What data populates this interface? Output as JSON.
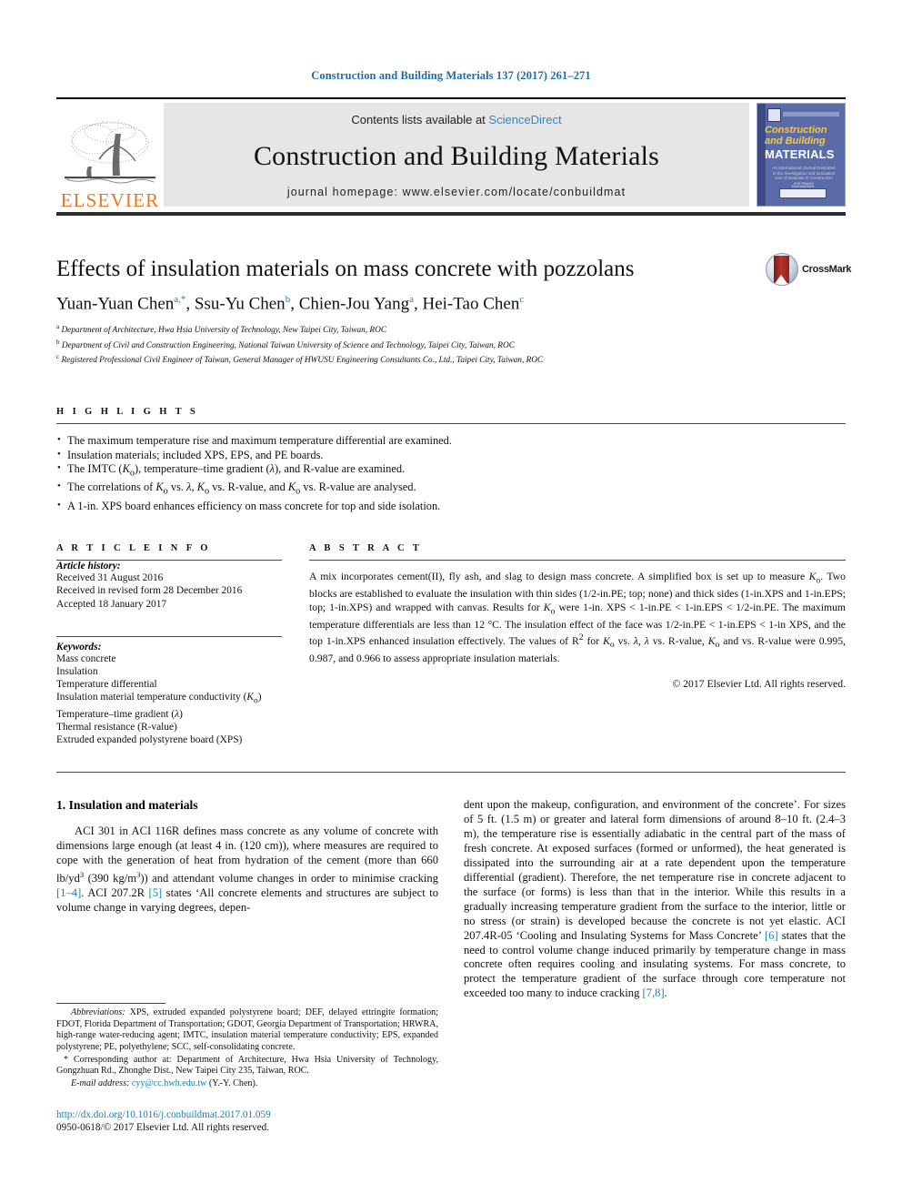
{
  "running_head": "Construction and Building Materials 137 (2017) 261–271",
  "masthead": {
    "publisher_name": "ELSEVIER",
    "contents_prefix": "Contents lists available at ",
    "contents_link": "ScienceDirect",
    "journal_title": "Construction and Building Materials",
    "homepage_label": "journal homepage: www.elsevier.com/locate/conbuildmat",
    "cover": {
      "line1": "Construction",
      "line2": "and Building",
      "line3": "MATERIALS",
      "blurb": "An International Journal Dedicated to the Investigation and Innovative Use of Materials in Construction and Repair",
      "footer_label": "ScienceDirect"
    }
  },
  "article": {
    "title": "Effects of insulation materials on mass concrete with pozzolans",
    "authors_html": "Yuan-Yuan Chen<sup>a,*</sup>, Ssu-Yu Chen<sup>b</sup>, Chien-Jou Yang<sup>a</sup>, Hei-Tao Chen<sup>c</sup>",
    "affiliations": [
      "Department of Architecture, Hwa Hsia University of Technology, New Taipei City, Taiwan, ROC",
      "Department of Civil and Construction Engineering, National Taiwan University of Science and Technology, Taipei City, Taiwan, ROC",
      "Registered Professional Civil Engineer of Taiwan, General Manager of HWUSU Engineering Consultants Co., Ltd., Taipei City, Taiwan, ROC"
    ],
    "affiliation_markers": [
      "a",
      "b",
      "c"
    ],
    "crossmark_label": "CrossMark"
  },
  "highlights": {
    "heading": "H I G H L I G H T S",
    "items_html": [
      "The maximum temperature rise and maximum temperature differential are examined.",
      "Insulation materials; included XPS, EPS, and PE boards.",
      "The IMTC (<i>K</i><sub>o</sub>), temperature–time gradient (<i>&lambda;</i>), and R-value are examined.",
      "The correlations of <i>K</i><sub>o</sub> vs. <i>&lambda;</i>, <i>K</i><sub>o</sub> vs. R-value, and <i>K</i><sub>o</sub> vs. R-value are analysed.",
      "A 1-in. XPS board enhances efficiency on mass concrete for top and side isolation."
    ]
  },
  "article_info": {
    "heading": "A R T I C L E   I N F O",
    "history_title": "Article history:",
    "history": [
      "Received 31 August 2016",
      "Received in revised form 28 December 2016",
      "Accepted 18 January 2017"
    ],
    "keywords_title": "Keywords:",
    "keywords_html": [
      "Mass concrete",
      "Insulation",
      "Temperature differential",
      "Insulation material temperature conductivity (<i>K</i><sub>o</sub>)",
      "Temperature–time gradient (<i>&lambda;</i>)",
      "Thermal resistance (R-value)",
      "Extruded expanded polystyrene board (XPS)"
    ]
  },
  "abstract": {
    "heading": "A B S T R A C T",
    "body_html": "A mix incorporates cement(II), fly ash, and slag to design mass concrete. A simplified box is set up to measure <i>K</i><sub>o</sub>. Two blocks are established to evaluate the insulation with thin sides (1/2-in.PE; top; none) and thick sides (1-in.XPS and 1-in.EPS; top; 1-in.XPS) and wrapped with canvas. Results for <i>K</i><sub>o</sub> were 1-in. XPS &lt; 1-in.PE &lt; 1-in.EPS &lt; 1/2-in.PE. The maximum temperature differentials are less than 12 &deg;C. The insulation effect of the face was 1/2-in.PE &lt; 1-in.EPS &lt; 1-in XPS, and the top 1-in.XPS enhanced insulation effectively. The values of R<sup>2</sup> for <i>K</i><sub>o</sub> vs. <i>&lambda;</i>, <i>&lambda;</i> vs. R-value, <i>K</i><sub>o</sub> and vs. R-value were 0.995, 0.987, and 0.966 to assess appropriate insulation materials.",
    "copyright": "© 2017 Elsevier Ltd. All rights reserved."
  },
  "body": {
    "section_heading": "1. Insulation and materials",
    "left_paragraph_html": "ACI 301 in ACI 116R defines mass concrete as any volume of concrete with dimensions large enough (at least 4 in. (120 cm)), where measures are required to cope with the generation of heat from hydration of the cement (more than 660 lb/yd<sup>3</sup> (390 kg/m<sup>3</sup>)) and attendant volume changes in order to minimise cracking <span class=\"ref\">[1–4]</span>. ACI 207.2R <span class=\"ref\">[5]</span> states ‘All concrete elements and structures are subject to volume change in varying degrees, depen-",
    "right_paragraph_html": "dent upon the makeup, configuration, and environment of the concrete’. For sizes of 5 ft. (1.5 m) or greater and lateral form dimensions of around 8–10 ft. (2.4–3 m), the temperature rise is essentially adiabatic in the central part of the mass of fresh concrete. At exposed surfaces (formed or unformed), the heat generated is dissipated into the surrounding air at a rate dependent upon the temperature differential (gradient). Therefore, the net temperature rise in concrete adjacent to the surface (or forms) is less than that in the interior. While this results in a gradually increasing temperature gradient from the surface to the interior, little or no stress (or strain) is developed because the concrete is not yet elastic. ACI 207.4R-05 ‘Cooling and Insulating Systems for Mass Concrete’ <span class=\"ref\">[6]</span> states that the need to control volume change induced primarily by temperature change in mass concrete often requires cooling and insulating systems. For mass concrete, to protect the temperature gradient of the surface through core temperature not exceeded too many to induce cracking <span class=\"ref\">[7,8]</span>."
  },
  "footnotes": {
    "abbreviations_html": "<i>Abbreviations:</i> XPS, extruded expanded polystyrene board; DEF, delayed ettringite formation; FDOT, Florida Department of Transportation; GDOT, Georgia Department of Transportation; HRWRA, high-range water-reducing agent; IMTC, insulation material temperature conductivity; EPS, expanded polystyrene; PE, polyethylene; SCC, self-consolidating concrete.",
    "corresponding_html": "* Corresponding author at: Department of Architecture, Hwa Hsia University of Technology, Gongzhuan Rd., Zhonghe Dist., New Taipei City 235, Taiwan, ROC.",
    "email_html": "<i>E-mail address:</i> <span class=\"link\">cyy@cc.hwh.edu.tw</span> (Y.-Y. Chen)."
  },
  "footer": {
    "doi": "http://dx.doi.org/10.1016/j.conbuildmat.2017.01.059",
    "issn": "0950-0618/© 2017 Elsevier Ltd. All rights reserved."
  },
  "colors": {
    "link_blue": "#1a7fb5",
    "elsevier_orange": "#E87722",
    "cover_blue": "#5b6ba8",
    "cover_yellow": "#f5c842",
    "band_gray": "#e6e6e6"
  }
}
